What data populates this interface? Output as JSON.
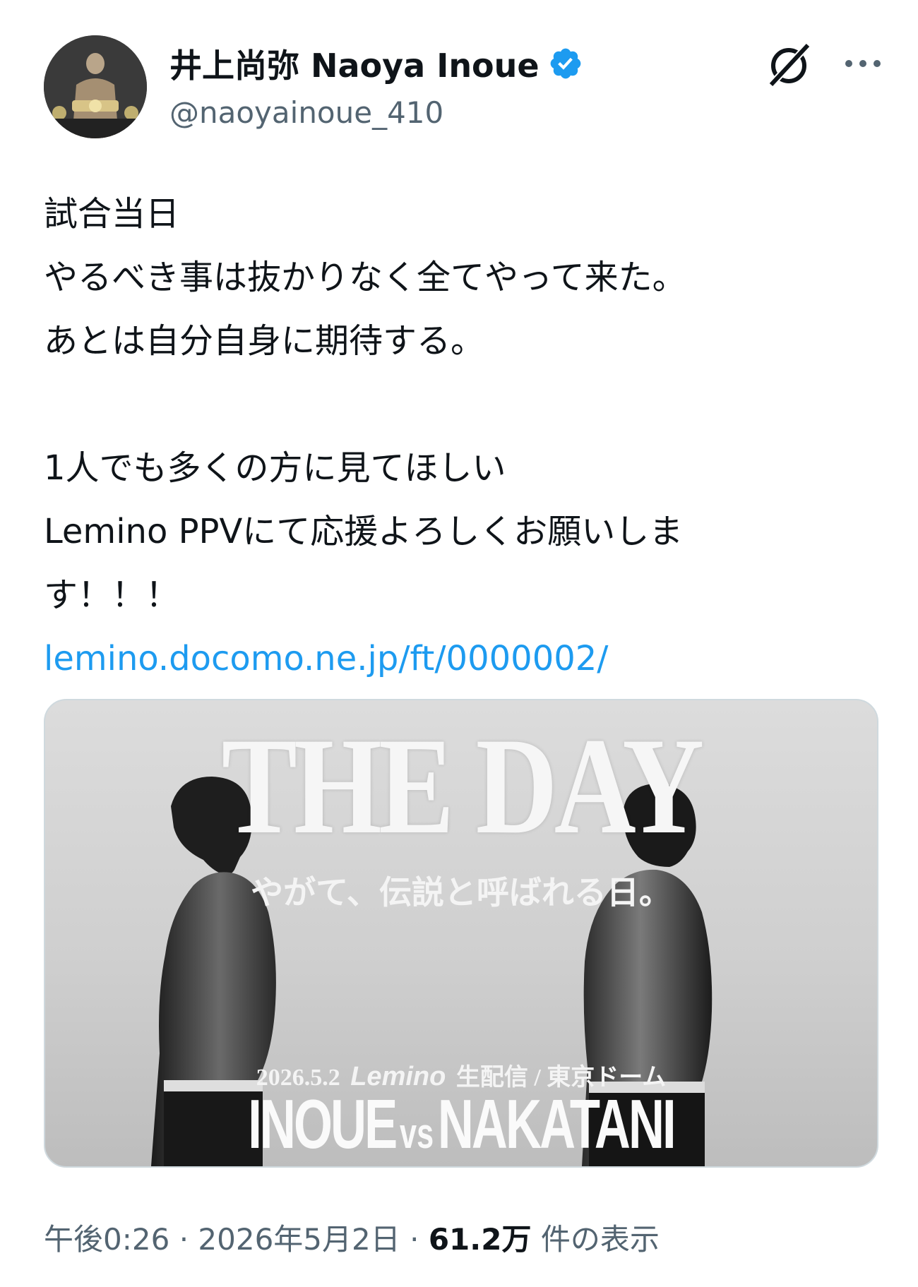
{
  "author": {
    "display_name": "井上尚弥 Naoya Inoue",
    "handle": "@naoyainoue_410",
    "verified": true
  },
  "tweet": {
    "lines": [
      "試合当日",
      "やるべき事は抜かりなく全てやって来た。",
      "あとは自分自身に期待する。",
      "",
      "1人でも多くの方に見てほしい",
      "Lemino PPVにて応援よろしくお願いしま",
      "す！！！"
    ],
    "link": "lemino.docomo.ne.jp/ft/0000002/"
  },
  "media": {
    "title": "THE DAY",
    "subtitle": "やがて、伝説と呼ばれる日。",
    "date": "2026.5.2",
    "brand": "Lemino",
    "broadcast": "生配信 / 東京ドーム",
    "fighter_left": "INOUE",
    "vs": "vs",
    "fighter_right": "NAKATANI"
  },
  "meta": {
    "time": "午後0:26",
    "separator": "·",
    "date": "2026年5月2日",
    "views_count": "61.2万",
    "views_label": "件の表示"
  },
  "colors": {
    "link": "#1d9bf0",
    "verified": "#1d9bf0",
    "muted": "#536471",
    "text": "#0f1419"
  },
  "icons": {
    "verified": "verified-badge-icon",
    "grok": "grok-icon",
    "more": "more-dots-icon"
  }
}
